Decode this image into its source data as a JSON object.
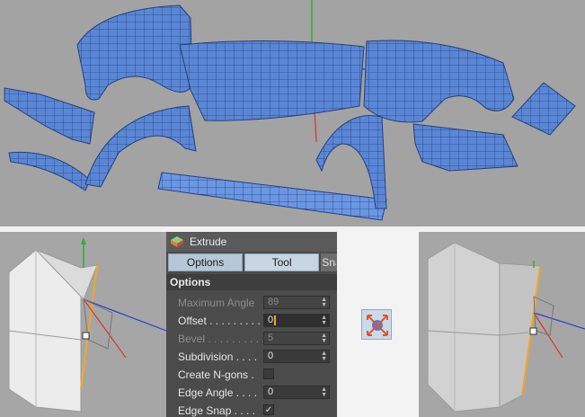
{
  "panel": {
    "title": "Extrude",
    "tabs": [
      "Options",
      "Tool",
      "Sna"
    ],
    "section": "Options",
    "rows": [
      {
        "label": "Maximum Angle",
        "value": "89",
        "enabled": false,
        "type": "number"
      },
      {
        "label": "Offset . . . . . . . . . .",
        "value": "0",
        "enabled": true,
        "type": "number",
        "editing": true
      },
      {
        "label": "Bevel . . . . . . . . . .",
        "value": "5",
        "enabled": false,
        "type": "number"
      },
      {
        "label": "Subdivision . . . .",
        "value": "0",
        "enabled": true,
        "type": "number"
      },
      {
        "label": "Create N-gons .",
        "checked": false,
        "enabled": true,
        "type": "checkbox"
      },
      {
        "label": "Edge Angle . . . .",
        "value": "0",
        "enabled": true,
        "type": "number"
      },
      {
        "label": "Edge Snap . . . .",
        "checked": true,
        "enabled": true,
        "type": "checkbox"
      }
    ]
  },
  "icons": {
    "extrude": "extrude-icon",
    "move_tool": "move-arrows-icon",
    "checkmark": "✓",
    "spinner": "▲▼"
  },
  "colors": {
    "mesh_blue": "#5a86d6",
    "viewport_gray": "#a3a3a3",
    "panel_bg": "#4b4b4b",
    "active_tab": "#b6c7d8",
    "edge_highlight": "#f5a623",
    "axis_x": "#d9342b",
    "axis_y": "#2fae3a",
    "axis_z": "#2f3fd0"
  }
}
